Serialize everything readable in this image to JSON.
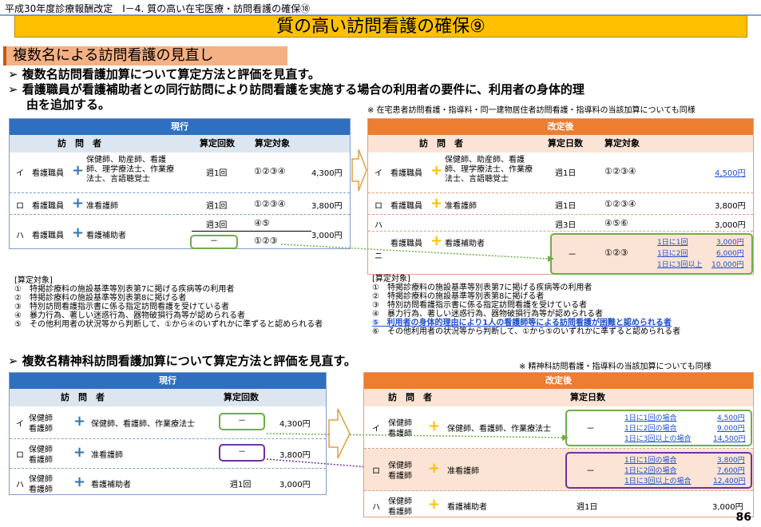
{
  "header": {
    "caption": "平成30年度診療報酬改定　Ⅰ－4. 質の高い在宅医療・訪問看護の確保⑱",
    "title": "質の高い訪問看護の確保⑨"
  },
  "section1": {
    "heading": "複数名による訪問看護の見直し",
    "bullets": [
      "複数名訪問看護加算について算定方法と評価を見直す。",
      "看護職員が看護補助者との同行訪問により訪問看護を実施する場合の利用者の要件に、利用者の身体的理",
      "由を追加する。"
    ],
    "note": "※ 在宅患者訪問看護・指導料・同一建物居住者訪問看護・指導料の当該加算についても同様"
  },
  "table1_old": {
    "header": "現行",
    "col_visitor": "訪　問　者",
    "col_count": "算定回数",
    "col_target": "算定対象",
    "rows": [
      {
        "mark": "イ",
        "a": "看護職員",
        "b": "保健師、助産師、看護師、理学療法士、作業療法士、言語聴覚士",
        "count": "週1回",
        "target": "①②③④",
        "price": "4,300円"
      },
      {
        "mark": "ロ",
        "a": "看護職員",
        "b": "准看護師",
        "count": "週1回",
        "target": "①②③④",
        "price": "3,800円"
      },
      {
        "mark": "ハ",
        "a": "看護職員",
        "b": "看護補助者",
        "count": "週3回",
        "target": "④⑤",
        "count2": "－",
        "target2": "①②③",
        "price": "3,000円"
      }
    ]
  },
  "table1_new": {
    "header": "改定後",
    "col_visitor": "訪　問　者",
    "col_count": "算定日数",
    "col_target": "算定対象",
    "rows": [
      {
        "mark": "イ",
        "a": "看護職員",
        "b": "保健師、助産師、看護師、理学療法士、作業療法士、言語聴覚士",
        "count": "週1日",
        "target": "①②③④",
        "price": "4,500円"
      },
      {
        "mark": "ロ",
        "a": "看護職員",
        "b": "准看護師",
        "count": "週1日",
        "target": "①②③④",
        "price": "3,800円"
      },
      {
        "mark": "ハ",
        "count": "週3日",
        "target": "④⑤⑥",
        "price": "3,000円"
      },
      {
        "mark": "ニ",
        "a": "看護職員",
        "b": "看護補助者",
        "count": "－",
        "target": "①②③",
        "tiers": [
          {
            "l": "1日に1回",
            "p": "3,000円"
          },
          {
            "l": "1日に2回",
            "p": "6,000円"
          },
          {
            "l": "1日に3回以上",
            "p": "10,000円"
          }
        ]
      }
    ]
  },
  "criteria_old": {
    "title": "[算定対象]",
    "items": [
      "①　特掲診療料の施設基準等別表第7に掲げる疾病等の利用者",
      "②　特掲診療料の施設基準等別表第8に掲げる者",
      "③　特別訪問看護指示書に係る指定訪問看護を受けている者",
      "④　暴力行為、著しい迷惑行為、器物破損行為等が認められる者",
      "⑤　その他利用者の状況等から判断して、①から④のいずれかに準ずると認められる者"
    ]
  },
  "criteria_new": {
    "title": "[算定対象]",
    "items": [
      "①　特掲診療料の施設基準等別表第7に掲げる疾病等の利用者",
      "②　特掲診療料の施設基準等別表第8に掲げる者",
      "③　特別訪問看護指示書に係る指定訪問看護を受けている者",
      "④　暴力行為、著しい迷惑行為、器物破損行為等が認められる者",
      "⑤　利用者の身体的理由により1人の看護師等による訪問看護が困難と認められる者",
      "⑥　その他利用者の状況等から判断して、①から⑤のいずれかに準ずると認められる者"
    ]
  },
  "section2": {
    "bullet": "複数名精神科訪問看護加算について算定方法と評価を見直す。",
    "note": "※ 精神科訪問看護・指導料の当該加算についても同様"
  },
  "table2_old": {
    "header": "現行",
    "col_visitor": "訪　問　者",
    "col_count": "算定回数",
    "rows": [
      {
        "mark": "イ",
        "a1": "保健師",
        "a2": "看護師",
        "b": "保健師、看護師、作業療法士",
        "count": "－",
        "price": "4,300円"
      },
      {
        "mark": "ロ",
        "a1": "保健師",
        "a2": "看護師",
        "b": "准看護師",
        "count": "－",
        "price": "3,800円"
      },
      {
        "mark": "ハ",
        "a1": "保健師",
        "a2": "看護師",
        "b": "看護補助者",
        "count": "週1回",
        "price": "3,000円"
      }
    ]
  },
  "table2_new": {
    "header": "改定後",
    "col_visitor": "訪　問　者",
    "col_count": "算定日数",
    "rows": [
      {
        "mark": "イ",
        "a1": "保健師",
        "a2": "看護師",
        "b": "保健師、看護師、作業療法士",
        "count": "－",
        "tiers": [
          {
            "l": "1日に1回の場合",
            "p": "4,500円"
          },
          {
            "l": "1日に2回の場合",
            "p": "9,000円"
          },
          {
            "l": "1日に3回以上の場合",
            "p": "14,500円"
          }
        ]
      },
      {
        "mark": "ロ",
        "a1": "保健師",
        "a2": "看護師",
        "b": "准看護師",
        "count": "－",
        "tiers": [
          {
            "l": "1日に1回の場合",
            "p": "3,800円"
          },
          {
            "l": "1日に2回の場合",
            "p": "7,600円"
          },
          {
            "l": "1日に3回以上の場合",
            "p": "12,400円"
          }
        ]
      },
      {
        "mark": "ハ",
        "a1": "保健師",
        "a2": "看護師",
        "b": "看護補助者",
        "count": "週1日",
        "price": "3,000円"
      }
    ]
  },
  "page_number": "86"
}
